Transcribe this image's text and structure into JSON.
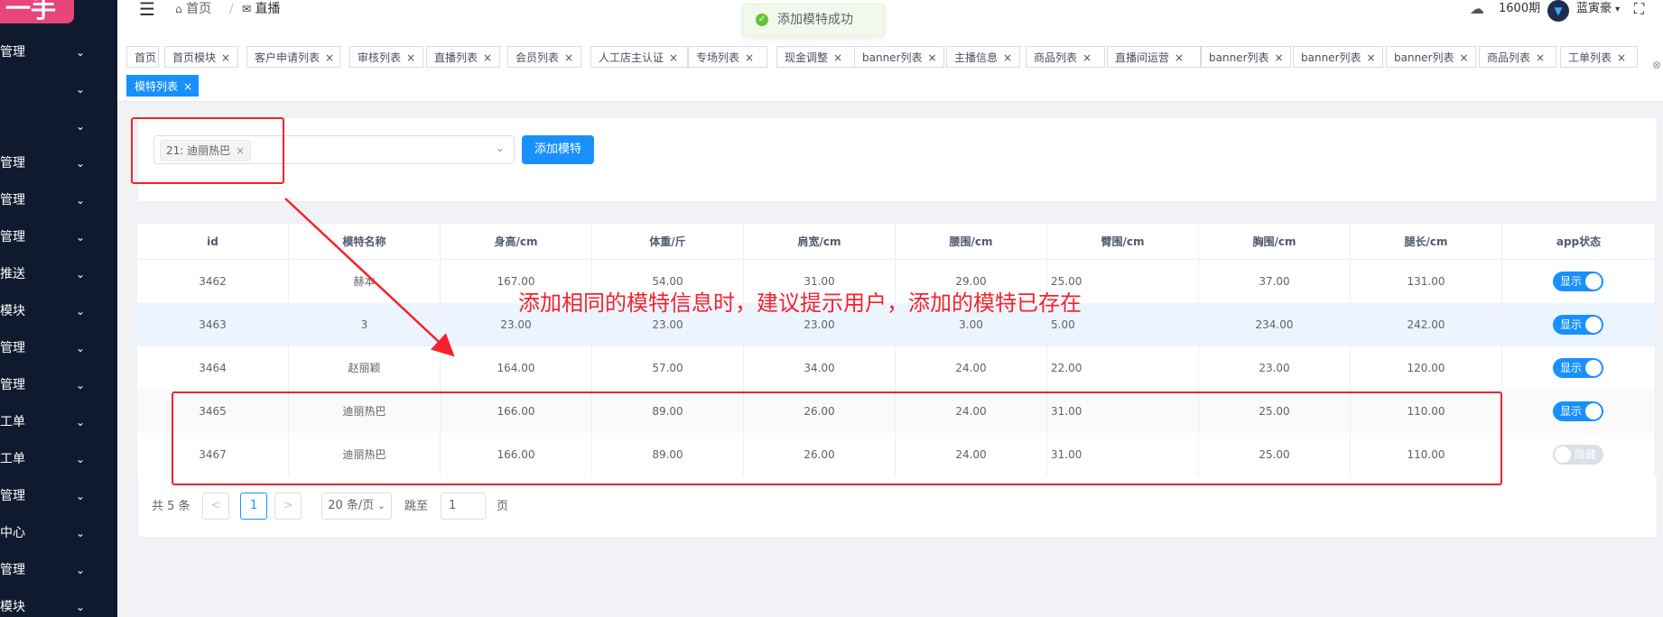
{
  "logo": "一手",
  "sidebar": {
    "items": [
      {
        "label": "管理"
      },
      {
        "label": ""
      },
      {
        "label": ""
      },
      {
        "label": "管理"
      },
      {
        "label": "管理"
      },
      {
        "label": "管理"
      },
      {
        "label": "推送"
      },
      {
        "label": "模块"
      },
      {
        "label": "管理"
      },
      {
        "label": "管理"
      },
      {
        "label": "工单"
      },
      {
        "label": "工单"
      },
      {
        "label": "管理"
      },
      {
        "label": "中心"
      },
      {
        "label": "管理"
      },
      {
        "label": "模块"
      }
    ],
    "chevron": "⌄"
  },
  "header": {
    "breadcrumb": [
      {
        "label": "首页",
        "icon": "home-icon"
      },
      {
        "label": "直播",
        "icon": "mail-icon"
      }
    ],
    "period": "1600期",
    "username": "蓝寅豪"
  },
  "toast": {
    "text": "添加模特成功",
    "color": "#67c23a"
  },
  "tags": [
    {
      "label": "首页",
      "closable": false
    },
    {
      "label": "首页模块"
    },
    {
      "label": "客户申请列表"
    },
    {
      "label": "审核列表"
    },
    {
      "label": "直播列表"
    },
    {
      "label": "会员列表"
    },
    {
      "label": "人工店主认证"
    },
    {
      "label": "专场列表"
    },
    {
      "label": "现金调整"
    },
    {
      "label": "banner列表"
    },
    {
      "label": "主播信息"
    },
    {
      "label": "商品列表"
    },
    {
      "label": "直播间运营"
    },
    {
      "label": "banner列表"
    },
    {
      "label": "banner列表"
    },
    {
      "label": "banner列表"
    },
    {
      "label": "商品列表"
    },
    {
      "label": "工单列表"
    },
    {
      "label": "模特列表",
      "active": true
    }
  ],
  "form": {
    "selected_chip": "21: 迪丽热巴",
    "add_button": "添加模特"
  },
  "table": {
    "columns": [
      "id",
      "模特名称",
      "身高/cm",
      "体重/斤",
      "肩宽/cm",
      "腰围/cm",
      "臂围/cm",
      "胸围/cm",
      "腿长/cm",
      "app状态"
    ],
    "rows": [
      {
        "id": "3462",
        "name": "赫本",
        "height": "167.00",
        "weight": "54.00",
        "shoulder": "31.00",
        "waist": "29.00",
        "arm": "25.00",
        "chest": "37.00",
        "leg": "131.00",
        "status": "显示",
        "on": true
      },
      {
        "id": "3463",
        "name": "3",
        "height": "23.00",
        "weight": "23.00",
        "shoulder": "23.00",
        "waist": "3.00",
        "arm": "5.00",
        "chest": "234.00",
        "leg": "242.00",
        "status": "显示",
        "on": true
      },
      {
        "id": "3464",
        "name": "赵丽颖",
        "height": "164.00",
        "weight": "57.00",
        "shoulder": "34.00",
        "waist": "24.00",
        "arm": "22.00",
        "chest": "23.00",
        "leg": "120.00",
        "status": "显示",
        "on": true
      },
      {
        "id": "3465",
        "name": "迪丽热巴",
        "height": "166.00",
        "weight": "89.00",
        "shoulder": "26.00",
        "waist": "24.00",
        "arm": "31.00",
        "chest": "25.00",
        "leg": "110.00",
        "status": "显示",
        "on": true
      },
      {
        "id": "3467",
        "name": "迪丽热巴",
        "height": "166.00",
        "weight": "89.00",
        "shoulder": "26.00",
        "waist": "24.00",
        "arm": "31.00",
        "chest": "25.00",
        "leg": "110.00",
        "status": "隐藏",
        "on": false
      }
    ]
  },
  "pagination": {
    "total": "共 5 条",
    "prev": "<",
    "current": "1",
    "next": ">",
    "page_size": "20 条/页",
    "jump_label": "跳至",
    "jump_value": "1",
    "page_suffix": "页"
  },
  "annotation": {
    "text": "添加相同的模特信息时，建议提示用户，添加的模特已存在",
    "color": "#f5222d"
  }
}
